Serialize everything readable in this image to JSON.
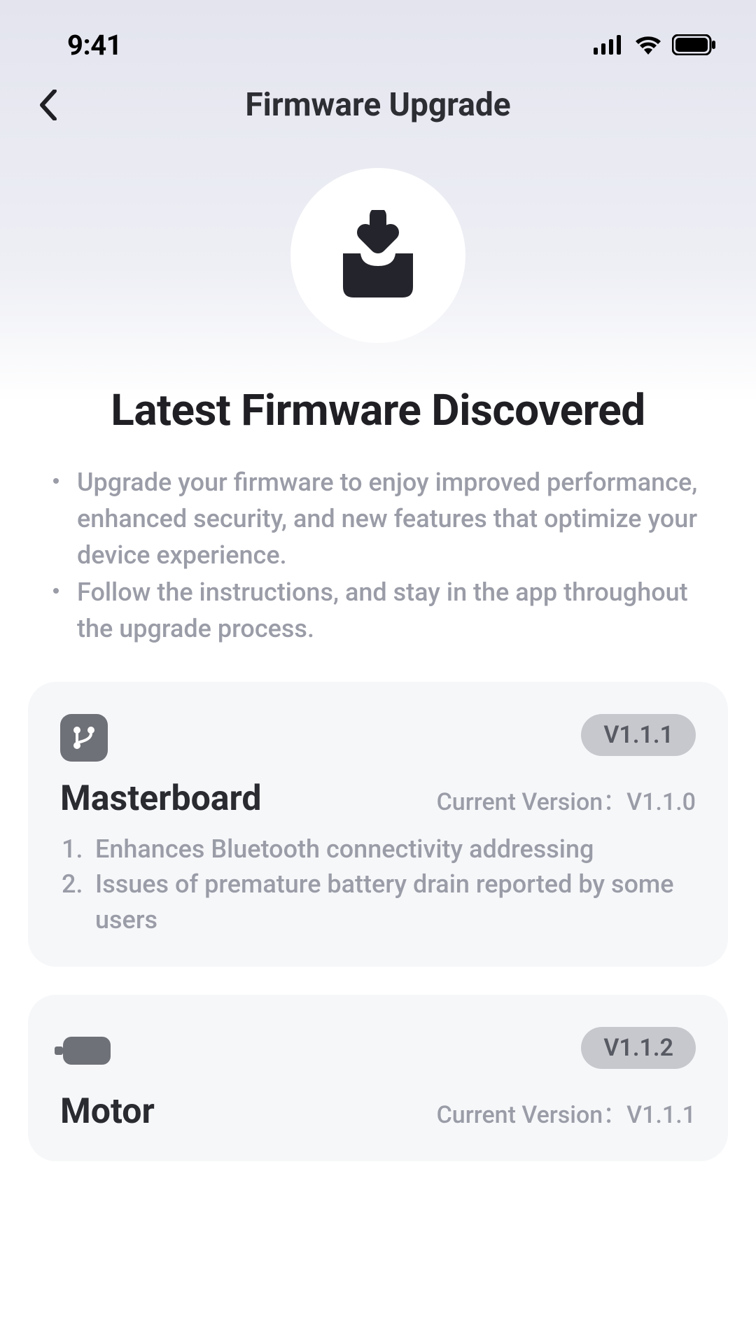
{
  "status": {
    "time": "9:41"
  },
  "nav": {
    "title": "Firmware Upgrade"
  },
  "heading": "Latest Firmware Discovered",
  "notes": [
    "Upgrade your firmware to enjoy improved performance, enhanced security, and new features that optimize your device experience.",
    "Follow the instructions, and stay in the app throughout the upgrade process."
  ],
  "cards": [
    {
      "icon": "masterboard",
      "name": "Masterboard",
      "new_version": "V1.1.1",
      "current_label": "Current Version：V1.1.0",
      "changes": [
        "Enhances Bluetooth connectivity addressing",
        "Issues of premature battery drain reported by some users"
      ]
    },
    {
      "icon": "motor",
      "name": "Motor",
      "new_version": "V1.1.2",
      "current_label": "Current Version：V1.1.1",
      "changes": []
    }
  ]
}
